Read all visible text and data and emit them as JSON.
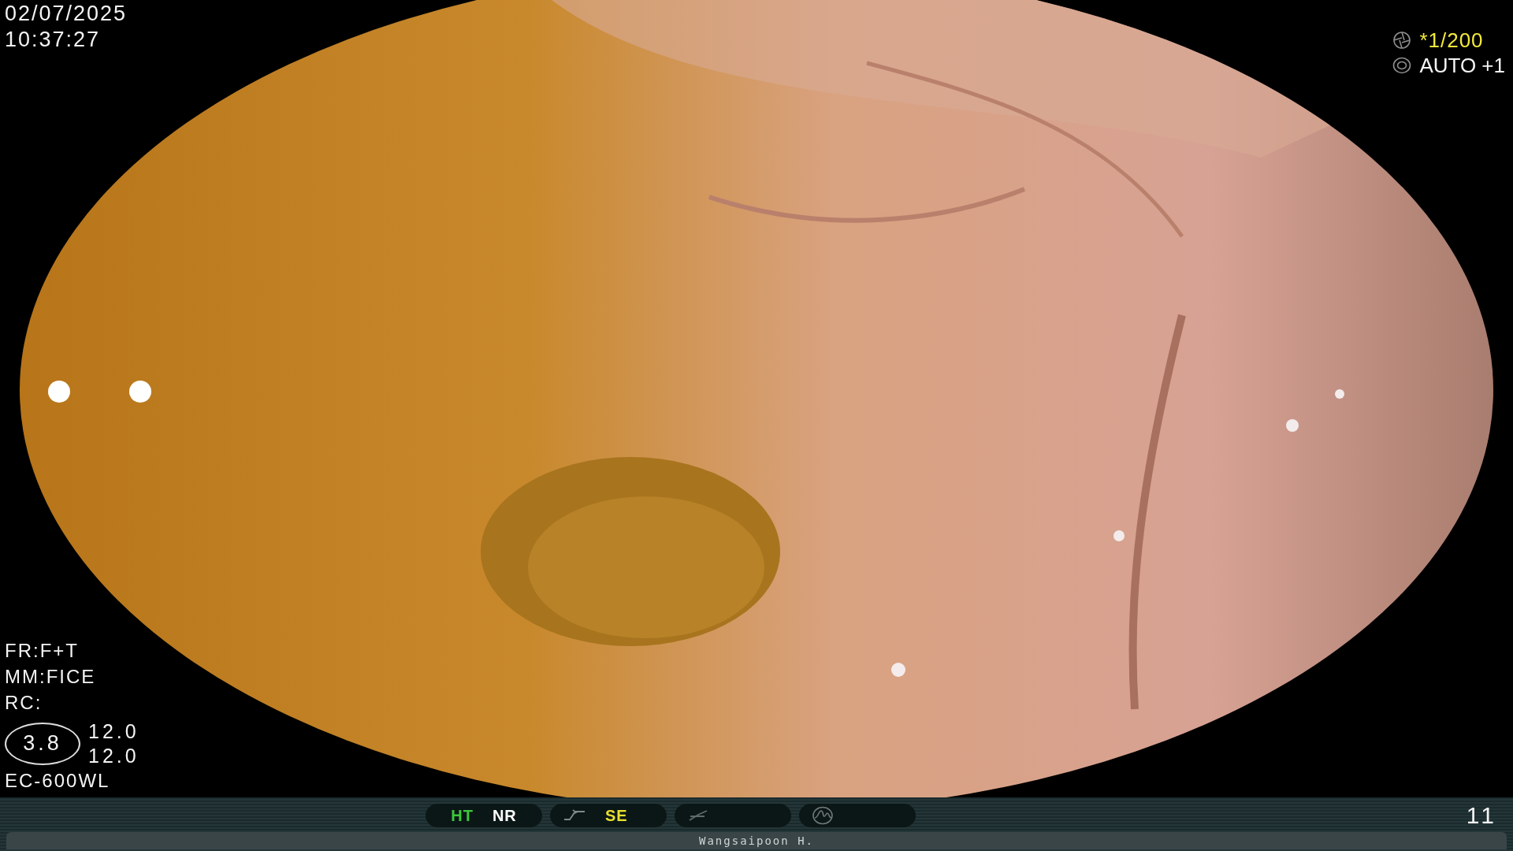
{
  "overlay": {
    "date": "02/07/2025",
    "time": "10:37:27",
    "shutter": "*1/200",
    "exposure": "AUTO +1",
    "settings": [
      "FR:F+T",
      "MM:FICE",
      "RC:"
    ],
    "zoom": "3.8",
    "readings": [
      "12.0",
      "12.0"
    ],
    "scope": "EC-600WL"
  },
  "status_bar": {
    "pills": [
      {
        "kind": "labels",
        "labels": [
          {
            "text": "HT",
            "color": "#3cc83c"
          },
          {
            "text": "NR",
            "color": "#ffffff"
          }
        ]
      },
      {
        "kind": "curve",
        "labels": [
          {
            "text": "SE",
            "color": "#e8e030"
          }
        ]
      },
      {
        "kind": "slash"
      },
      {
        "kind": "wave"
      }
    ],
    "counter": "11",
    "operator": "Wangsaipoon H."
  }
}
